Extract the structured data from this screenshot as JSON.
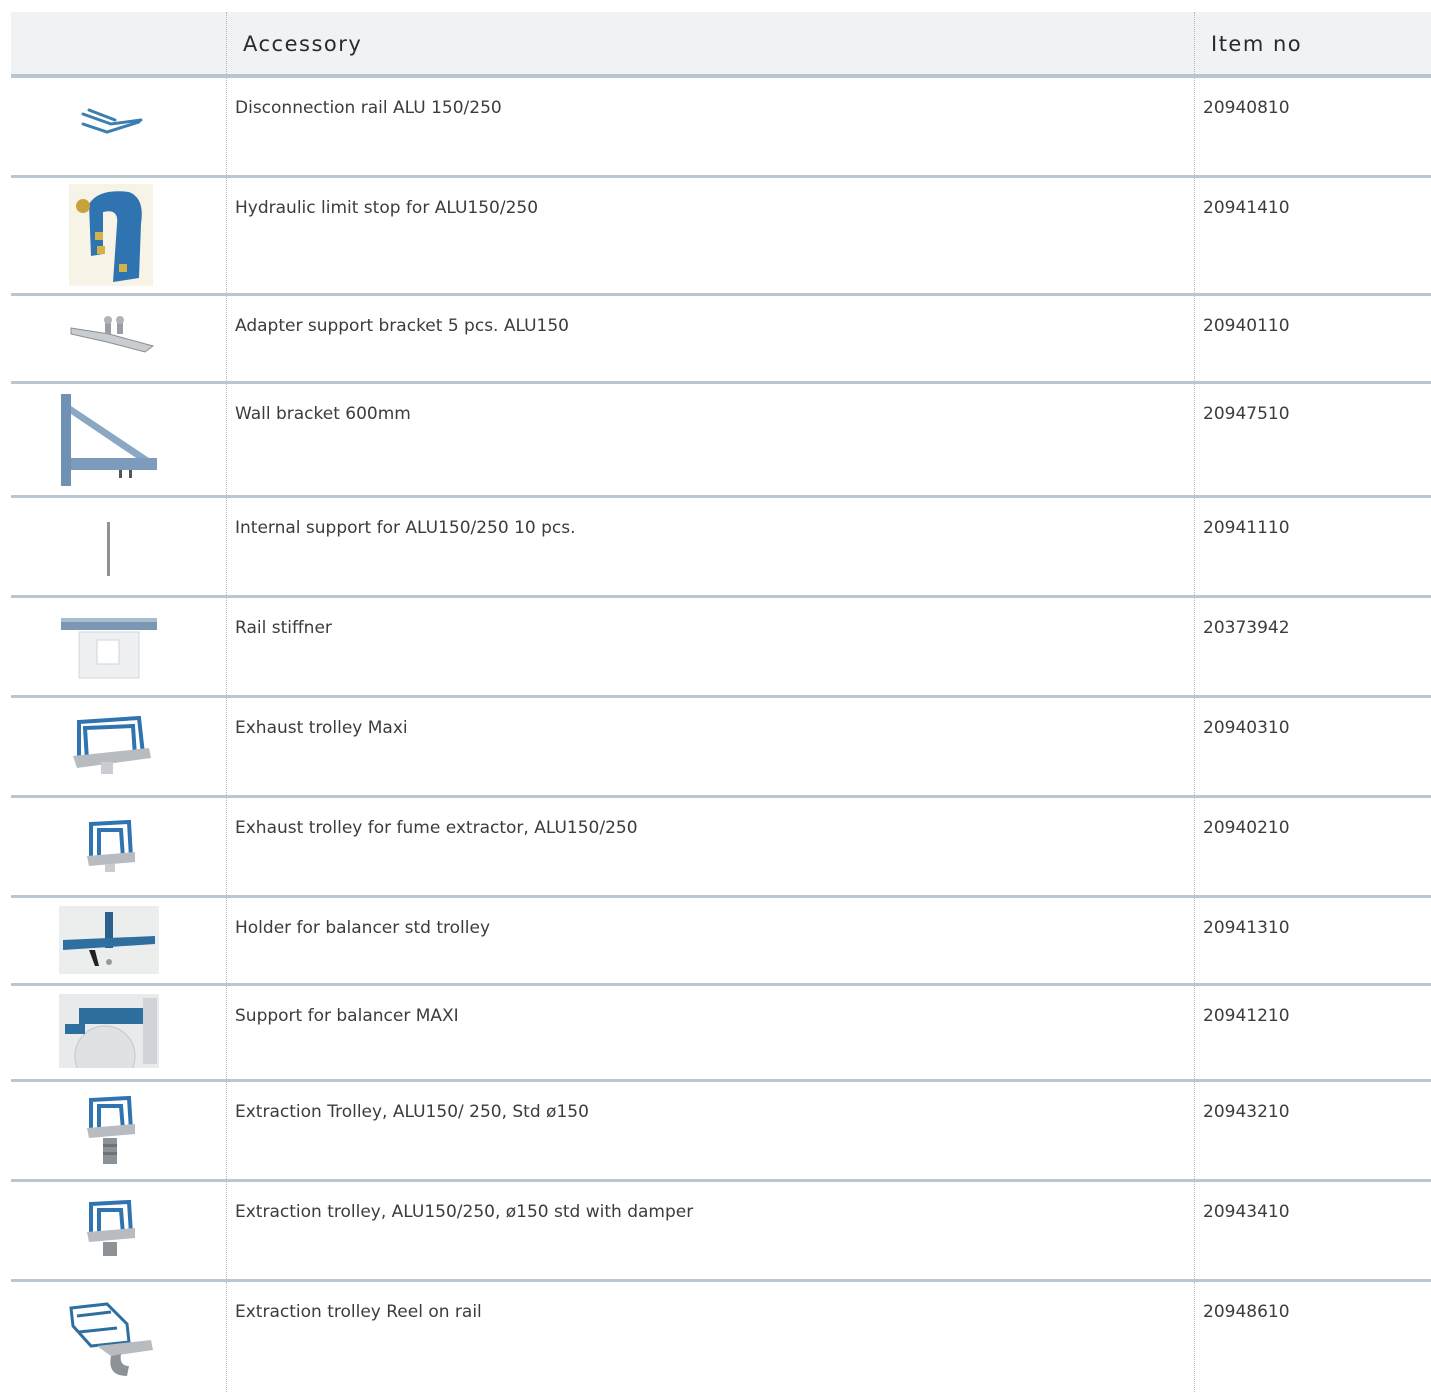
{
  "header": {
    "col_image": "",
    "col_accessory": "Accessory",
    "col_item_no": "Item no"
  },
  "rows": [
    {
      "name": "Disconnection rail ALU 150/250",
      "item_no": "20940810",
      "icon": "disconnection-rail-image"
    },
    {
      "name": "Hydraulic limit stop for ALU150/250",
      "item_no": "20941410",
      "icon": "hydraulic-limit-stop-image"
    },
    {
      "name": "Adapter support bracket 5 pcs. ALU150",
      "item_no": "20940110",
      "icon": "adapter-support-bracket-image"
    },
    {
      "name": "Wall bracket 600mm",
      "item_no": "20947510",
      "icon": "wall-bracket-image"
    },
    {
      "name": "Internal support for ALU150/250 10 pcs.",
      "item_no": "20941110",
      "icon": "internal-support-image"
    },
    {
      "name": "Rail stiffner",
      "item_no": "20373942",
      "icon": "rail-stiffner-image"
    },
    {
      "name": "Exhaust trolley Maxi",
      "item_no": "20940310",
      "icon": "exhaust-trolley-maxi-image"
    },
    {
      "name": "Exhaust trolley for fume extractor, ALU150/250",
      "item_no": "20940210",
      "icon": "exhaust-trolley-fume-image"
    },
    {
      "name": "Holder for balancer std trolley",
      "item_no": "20941310",
      "icon": "balancer-holder-image"
    },
    {
      "name": "Support for balancer MAXI",
      "item_no": "20941210",
      "icon": "balancer-support-image"
    },
    {
      "name": "Extraction Trolley, ALU150/ 250, Std ø150",
      "item_no": "20943210",
      "icon": "extraction-trolley-std-image"
    },
    {
      "name": "Extraction trolley, ALU150/250, ø150 std with damper",
      "item_no": "20943410",
      "icon": "extraction-trolley-damper-image"
    },
    {
      "name": "Extraction trolley Reel on rail",
      "item_no": "20948610",
      "icon": "extraction-trolley-reel-image"
    }
  ],
  "colors": {
    "accent_blue": "#2f6fa0",
    "divider": "#b9c8d0",
    "header_bg": "#f1f2f3"
  }
}
